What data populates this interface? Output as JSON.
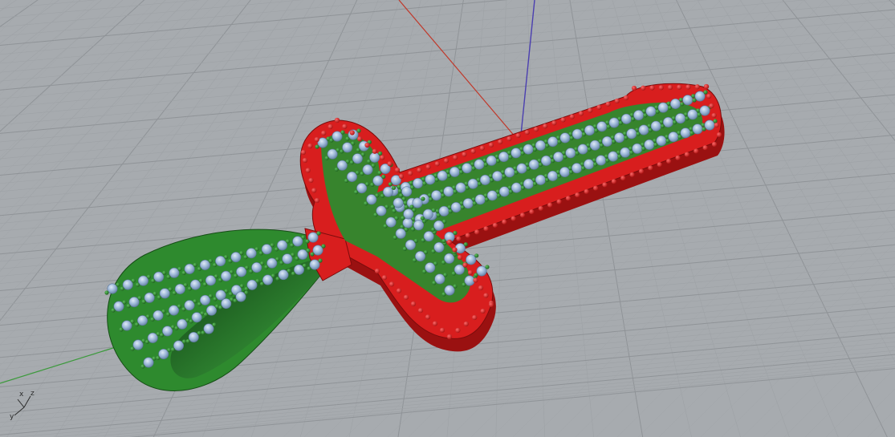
{
  "viewport": {
    "background_color": "#a7abaf",
    "grid_minor_color": "#9ea2a6",
    "grid_major_color": "#8f9397",
    "world_axis_colors": {
      "x": "#c0392b",
      "y": "#3c9a3c",
      "z": "#4b3fb0"
    }
  },
  "model": {
    "name": "cross-pendant-with-bail",
    "setting_metal_color": "#d81e1e",
    "prong_color": "#2e8a2e",
    "gem_color": "#9db8d8",
    "gem_icon": "round-gem-icon"
  },
  "axis_gizmo": {
    "x_label": "x",
    "y_label": "y",
    "z_label": "z"
  }
}
